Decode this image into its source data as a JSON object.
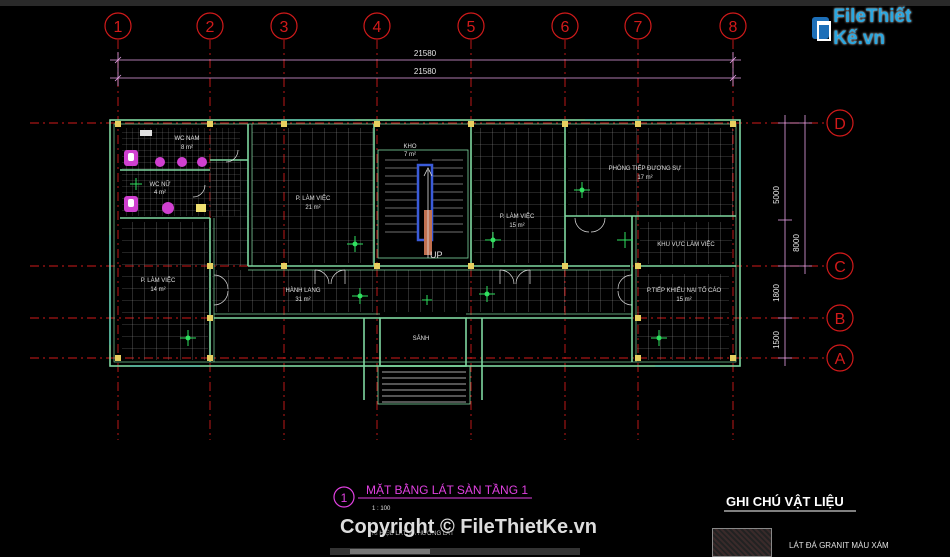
{
  "grid": {
    "columns": [
      "1",
      "2",
      "3",
      "4",
      "5",
      "6",
      "7",
      "8"
    ],
    "rows": [
      "D",
      "C",
      "B",
      "A"
    ]
  },
  "dimensions": {
    "overall_top": "21580",
    "overall_bottom": "21580",
    "right_5000": "5000",
    "right_8000": "8000",
    "right_1800": "1800",
    "right_1500": "1500"
  },
  "rooms": {
    "wc_nam": {
      "name": "WC NAM",
      "area": "8 m²"
    },
    "wc_nu": {
      "name": "WC NỮ",
      "area": "4 m²"
    },
    "kho": {
      "name": "KHO",
      "area": "7 m²"
    },
    "lam_viec_1": {
      "name": "P. LÀM VIỆC",
      "area": "21 m²"
    },
    "lam_viec_2": {
      "name": "P. LÀM VIỆC",
      "area": "15 m²"
    },
    "tiep_duong_su": {
      "name": "PHÒNG TIẾP ĐƯƠNG SỰ",
      "area": "17 m²"
    },
    "khu_vuc_lam_viec": {
      "name": "KHU VỰC LÀM VIỆC"
    },
    "lam_viec_3": {
      "name": "P. LÀM VIỆC",
      "area": "14 m²"
    },
    "hanh_lang": {
      "name": "HÀNH LANG",
      "area": "31 m²"
    },
    "tiep_khieu_nai": {
      "name": "P.TIẾP KHIẾU NẠI TỐ CÁO",
      "area": "15 m²"
    },
    "sanh": {
      "name": "SẢNH"
    },
    "up": "UP"
  },
  "title_block": {
    "number": "1",
    "title": "MẶT BẰNG LÁT SÀN TẦNG 1",
    "scale": "1 : 100",
    "note": "KÍ HIỆU LÁT VÀ HƯỚNG LÁT"
  },
  "legend": {
    "heading": "GHI CHÚ VẬT LIỆU",
    "item_1": "LÁT ĐÁ GRANIT MÀU XÁM"
  },
  "watermark": {
    "logo_text": "FileThiết Kế.vn",
    "copyright": "Copyright © FileThietKe.vn"
  },
  "colors": {
    "grid_axis": "#d11a1a",
    "wall": "#7fd8a0",
    "dimension": "#e6a0e6",
    "room_text": "#e0e0e0",
    "stair": "#3a5bd9",
    "title": "#e040e0",
    "tile": "#8a8a8a"
  }
}
